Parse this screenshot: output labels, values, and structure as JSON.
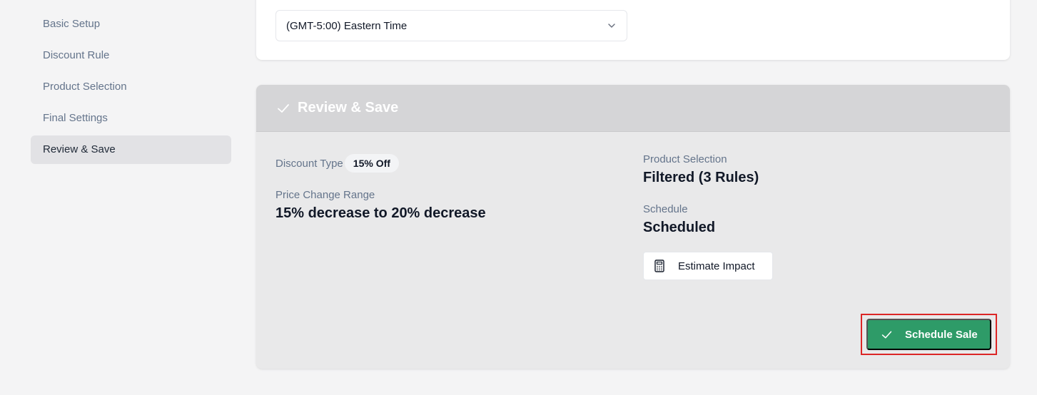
{
  "sidebar": {
    "items": [
      {
        "label": "Basic Setup"
      },
      {
        "label": "Discount Rule"
      },
      {
        "label": "Product Selection"
      },
      {
        "label": "Final Settings"
      },
      {
        "label": "Review & Save",
        "active": true
      }
    ]
  },
  "timezone": {
    "value": "(GMT-5:00) Eastern Time",
    "icon": "chevron-down-icon"
  },
  "review": {
    "title": "Review & Save",
    "header_icon": "check-icon",
    "discount_type_label": "Discount Type",
    "discount_type_value": "15% Off",
    "price_range_label": "Price Change Range",
    "price_range_value": "15% decrease to 20% decrease",
    "product_selection_label": "Product Selection",
    "product_selection_value": "Filtered (3 Rules)",
    "schedule_label": "Schedule",
    "schedule_value": "Scheduled",
    "estimate_label": "Estimate Impact",
    "estimate_icon": "calculator-icon",
    "schedule_button_label": "Schedule Sale",
    "schedule_button_icon": "check-icon"
  },
  "colors": {
    "primary_button": "#2e9b68",
    "highlight": "#dc2626"
  }
}
